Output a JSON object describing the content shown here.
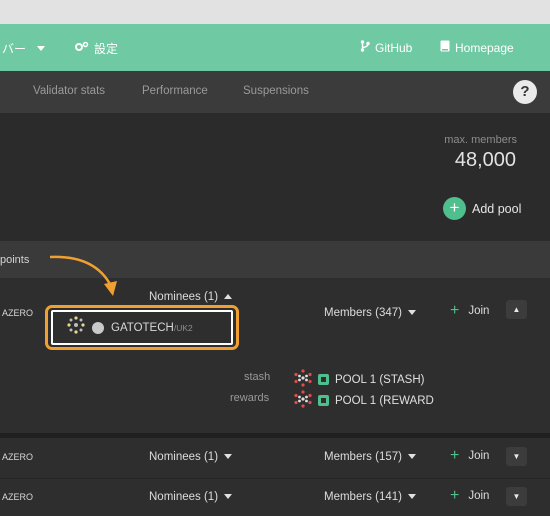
{
  "topbar": {
    "menu_label": "バー",
    "settings_label": "設定",
    "github_label": "GitHub",
    "homepage_label": "Homepage"
  },
  "subnav": {
    "tabs": [
      {
        "label": "Validator stats"
      },
      {
        "label": "Performance"
      },
      {
        "label": "Suspensions"
      }
    ],
    "help_label": "?"
  },
  "summary": {
    "max_members_label": "max. members",
    "max_members_value": "48,000",
    "add_pool_label": "Add pool",
    "add_pool_plus": "+"
  },
  "table": {
    "column_points": "points",
    "rows": [
      {
        "token": "AZERO",
        "nominees": "Nominees (1)",
        "members": "Members (347)",
        "join": "Join",
        "expand_glyph": "▲",
        "highlight_name": "GATOTECH",
        "highlight_sub": "/UK2",
        "stash_label": "stash",
        "stash_value": "POOL 1 (STASH)",
        "rewards_label": "rewards",
        "rewards_value": "POOL 1 (REWARD"
      },
      {
        "token": "AZERO",
        "nominees": "Nominees (1)",
        "members": "Members (157)",
        "join": "Join",
        "expand_glyph": "▼"
      },
      {
        "token": "AZERO",
        "nominees": "Nominees (1)",
        "members": "Members (141)",
        "join": "Join",
        "expand_glyph": "▼"
      }
    ]
  },
  "colors": {
    "accent_green": "#6fcaa3",
    "highlight_orange": "#f0a030"
  }
}
